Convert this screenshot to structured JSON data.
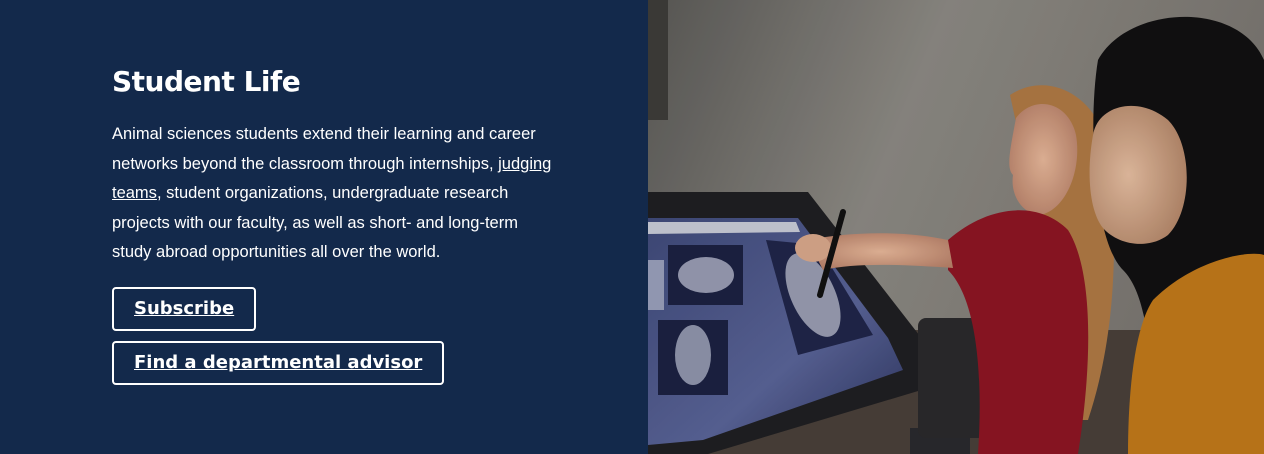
{
  "section": {
    "title": "Student Life",
    "body_before_link": "Animal sciences students extend their learning and career networks beyond the classroom through internships, ",
    "link_text": "judging teams",
    "body_after_link": ", student organizations, undergraduate research projects with our faculty, as well as short- and long-term study abroad opportunities all over the world."
  },
  "buttons": {
    "subscribe_label": "Subscribe",
    "advisor_label": "Find a departmental advisor"
  },
  "colors": {
    "panel_bg": "#13294b",
    "text": "#ffffff"
  }
}
